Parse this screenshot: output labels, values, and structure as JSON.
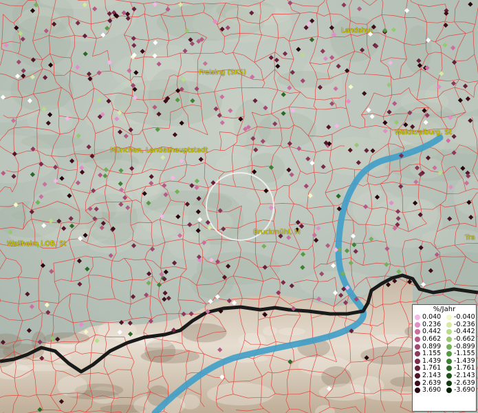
{
  "cities": [
    {
      "id": "landshut",
      "label": "Landshut"
    },
    {
      "id": "freising",
      "label": "Freising (SKS)"
    },
    {
      "id": "muenchen",
      "label": "München, Landeshauptstadt"
    },
    {
      "id": "waldkraiburg",
      "label": "Waldkraiburg, St"
    },
    {
      "id": "weilheim",
      "label": "Weilheim i.OB, St"
    },
    {
      "id": "bruckmuehl",
      "label": "Bruckmühl, M"
    },
    {
      "id": "traunstein",
      "label": "Tra"
    }
  ],
  "legend": {
    "title": "%/Jahr",
    "positive": [
      {
        "value": "0.040",
        "color": "#f2b8e6"
      },
      {
        "value": "0.236",
        "color": "#e08ec8"
      },
      {
        "value": "0.442",
        "color": "#c9709f"
      },
      {
        "value": "0.662",
        "color": "#b45a84"
      },
      {
        "value": "0.899",
        "color": "#a04870"
      },
      {
        "value": "1.155",
        "color": "#8c3a5c"
      },
      {
        "value": "1.439",
        "color": "#7a2c4a"
      },
      {
        "value": "1.761",
        "color": "#66203a"
      },
      {
        "value": "2.143",
        "color": "#521628"
      },
      {
        "value": "2.639",
        "color": "#3d0d1a"
      },
      {
        "value": "3.690",
        "color": "#26050c"
      }
    ],
    "negative": [
      {
        "value": "-0.040",
        "color": "#f4f7c8"
      },
      {
        "value": "-0.236",
        "color": "#d6eaa2"
      },
      {
        "value": "-0.442",
        "color": "#b8dc8a"
      },
      {
        "value": "-0.662",
        "color": "#96c872"
      },
      {
        "value": "-0.899",
        "color": "#74b05a"
      },
      {
        "value": "-1.155",
        "color": "#569846"
      },
      {
        "value": "-1.439",
        "color": "#3e8034"
      },
      {
        "value": "-1.761",
        "color": "#2a6a26"
      },
      {
        "value": "-2.143",
        "color": "#1c5418"
      },
      {
        "value": "-2.639",
        "color": "#0f3c0e"
      },
      {
        "value": "-3.690",
        "color": "#052205"
      }
    ]
  },
  "colors": {
    "border": "#e8322c",
    "river": "#3f9fc8",
    "national_border": "#1a1a1a",
    "label": "#e0d400"
  }
}
